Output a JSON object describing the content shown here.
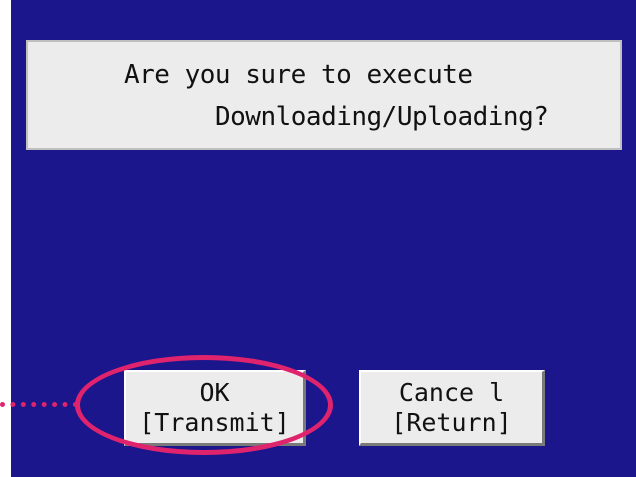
{
  "dialog": {
    "message_line1": "Are you sure to execute",
    "message_line2": "Downloading/Uploading?"
  },
  "buttons": {
    "ok": {
      "line1": "OK",
      "line2": "[Transmit]"
    },
    "cancel": {
      "line1": "Cance l",
      "line2": "[Return]"
    }
  },
  "colors": {
    "screen_background": "#1b168c",
    "panel_background": "#ececec",
    "highlight": "#e0236d"
  }
}
